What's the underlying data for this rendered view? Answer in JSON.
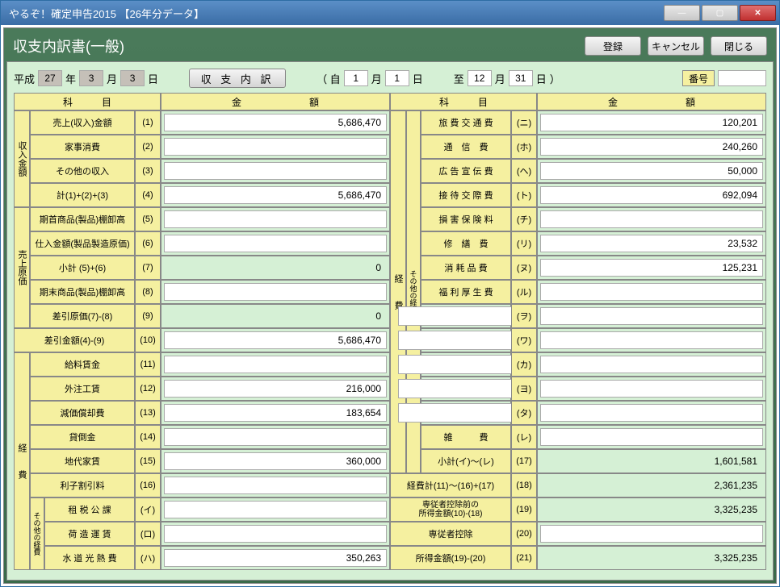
{
  "window_title": "やるぞ！確定申告2015 【26年分データ】",
  "page_title": "収支内訳書(一般)",
  "buttons": {
    "register": "登録",
    "cancel": "キャンセル",
    "close": "閉じる",
    "breakdown": "収 支 内 訳"
  },
  "date": {
    "era": "平成",
    "year": "27",
    "y_label": "年",
    "month": "3",
    "m_label": "月",
    "day": "3",
    "d_label": "日",
    "from_prefix": "（ 自",
    "from_m": "1",
    "from_d": "1",
    "to_prefix": "至",
    "to_m": "12",
    "to_d": "31",
    "suffix": "）",
    "bangou_label": "番号"
  },
  "headers": {
    "kamoku": "科　　　目",
    "kingaku": "金　　　　　　　額"
  },
  "vcat": {
    "shunyu": "収入金額",
    "genka": "売上原価",
    "keihi": "経　　費",
    "sonota": "その他の経費",
    "keihi_r": "経　　費",
    "sonota_r": "その他の経費"
  },
  "left": [
    {
      "cat": "shunyu",
      "label": "売上(収入)金額",
      "num": "(1)",
      "val": "5,686,470"
    },
    {
      "cat": "shunyu",
      "label": "家事消費",
      "num": "(2)",
      "val": ""
    },
    {
      "cat": "shunyu",
      "label": "その他の収入",
      "num": "(3)",
      "val": ""
    },
    {
      "cat": "shunyu",
      "label": "計(1)+(2)+(3)",
      "num": "(4)",
      "val": "5,686,470"
    },
    {
      "cat": "genka",
      "label": "期首商品(製品)棚卸高",
      "num": "(5)",
      "val": ""
    },
    {
      "cat": "genka",
      "label": "仕入金額(製品製造原価)",
      "num": "(6)",
      "val": ""
    },
    {
      "cat": "genka",
      "label": "小計 (5)+(6)",
      "num": "(7)",
      "val": "0",
      "calc": true
    },
    {
      "cat": "genka",
      "label": "期末商品(製品)棚卸高",
      "num": "(8)",
      "val": ""
    },
    {
      "cat": "genka",
      "label": "差引原価(7)-(8)",
      "num": "(9)",
      "val": "0",
      "calc": true
    },
    {
      "cat": "",
      "label": "差引金額(4)-(9)",
      "num": "(10)",
      "val": "5,686,470",
      "wide": true
    },
    {
      "cat": "keihi",
      "label": "給料賃金",
      "num": "(11)",
      "val": ""
    },
    {
      "cat": "keihi",
      "label": "外注工賃",
      "num": "(12)",
      "val": "216,000"
    },
    {
      "cat": "keihi",
      "label": "減価償却費",
      "num": "(13)",
      "val": "183,654"
    },
    {
      "cat": "keihi",
      "label": "貸倒金",
      "num": "(14)",
      "val": ""
    },
    {
      "cat": "keihi",
      "label": "地代家賃",
      "num": "(15)",
      "val": "360,000"
    },
    {
      "cat": "keihi",
      "label": "利子割引料",
      "num": "(16)",
      "val": ""
    },
    {
      "cat": "sonota",
      "label": "租 税 公 課",
      "num": "(イ)",
      "val": ""
    },
    {
      "cat": "sonota",
      "label": "荷 造 運 賃",
      "num": "(ロ)",
      "val": ""
    },
    {
      "cat": "sonota",
      "label": "水 道 光 熱 費",
      "num": "(ハ)",
      "val": "350,263"
    }
  ],
  "right": [
    {
      "cat": "sonota",
      "label": "旅 費 交 通 費",
      "num": "(ニ)",
      "val": "120,201"
    },
    {
      "cat": "sonota",
      "label": "通　信　費",
      "num": "(ホ)",
      "val": "240,260"
    },
    {
      "cat": "sonota",
      "label": "広 告 宣 伝 費",
      "num": "(ヘ)",
      "val": "50,000"
    },
    {
      "cat": "sonota",
      "label": "接 待 交 際 費",
      "num": "(ト)",
      "val": "692,094"
    },
    {
      "cat": "sonota",
      "label": "損 害 保 険 料",
      "num": "(チ)",
      "val": ""
    },
    {
      "cat": "sonota",
      "label": "修　繕　費",
      "num": "(リ)",
      "val": "23,532"
    },
    {
      "cat": "sonota",
      "label": "消 耗 品 費",
      "num": "(ヌ)",
      "val": "125,231"
    },
    {
      "cat": "sonota",
      "label": "福 利 厚 生 費",
      "num": "(ル)",
      "val": ""
    },
    {
      "cat": "sonota",
      "label": "",
      "num": "(ヲ)",
      "val": "",
      "edit": true
    },
    {
      "cat": "sonota",
      "label": "",
      "num": "(ワ)",
      "val": "",
      "edit": true
    },
    {
      "cat": "sonota",
      "label": "",
      "num": "(カ)",
      "val": "",
      "edit": true
    },
    {
      "cat": "sonota",
      "label": "",
      "num": "(ヨ)",
      "val": "",
      "edit": true
    },
    {
      "cat": "sonota",
      "label": "",
      "num": "(タ)",
      "val": "",
      "edit": true
    },
    {
      "cat": "sonota",
      "label": "雑　　　費",
      "num": "(レ)",
      "val": ""
    },
    {
      "cat": "sonota",
      "label": "小計(イ)～(レ)",
      "num": "(17)",
      "val": "1,601,581",
      "calc": true
    },
    {
      "cat": "",
      "label": "経費計(11)～(16)+(17)",
      "num": "(18)",
      "val": "2,361,235",
      "wide": true,
      "calc": true
    },
    {
      "cat": "",
      "label": "専従者控除前の\n所得金額(10)-(18)",
      "num": "(19)",
      "val": "3,325,235",
      "wide": true,
      "calc": true,
      "sm": true
    },
    {
      "cat": "",
      "label": "専従者控除",
      "num": "(20)",
      "val": "",
      "wide": true
    },
    {
      "cat": "",
      "label": "所得金額(19)-(20)",
      "num": "(21)",
      "val": "3,325,235",
      "wide": true,
      "calc": true
    }
  ]
}
